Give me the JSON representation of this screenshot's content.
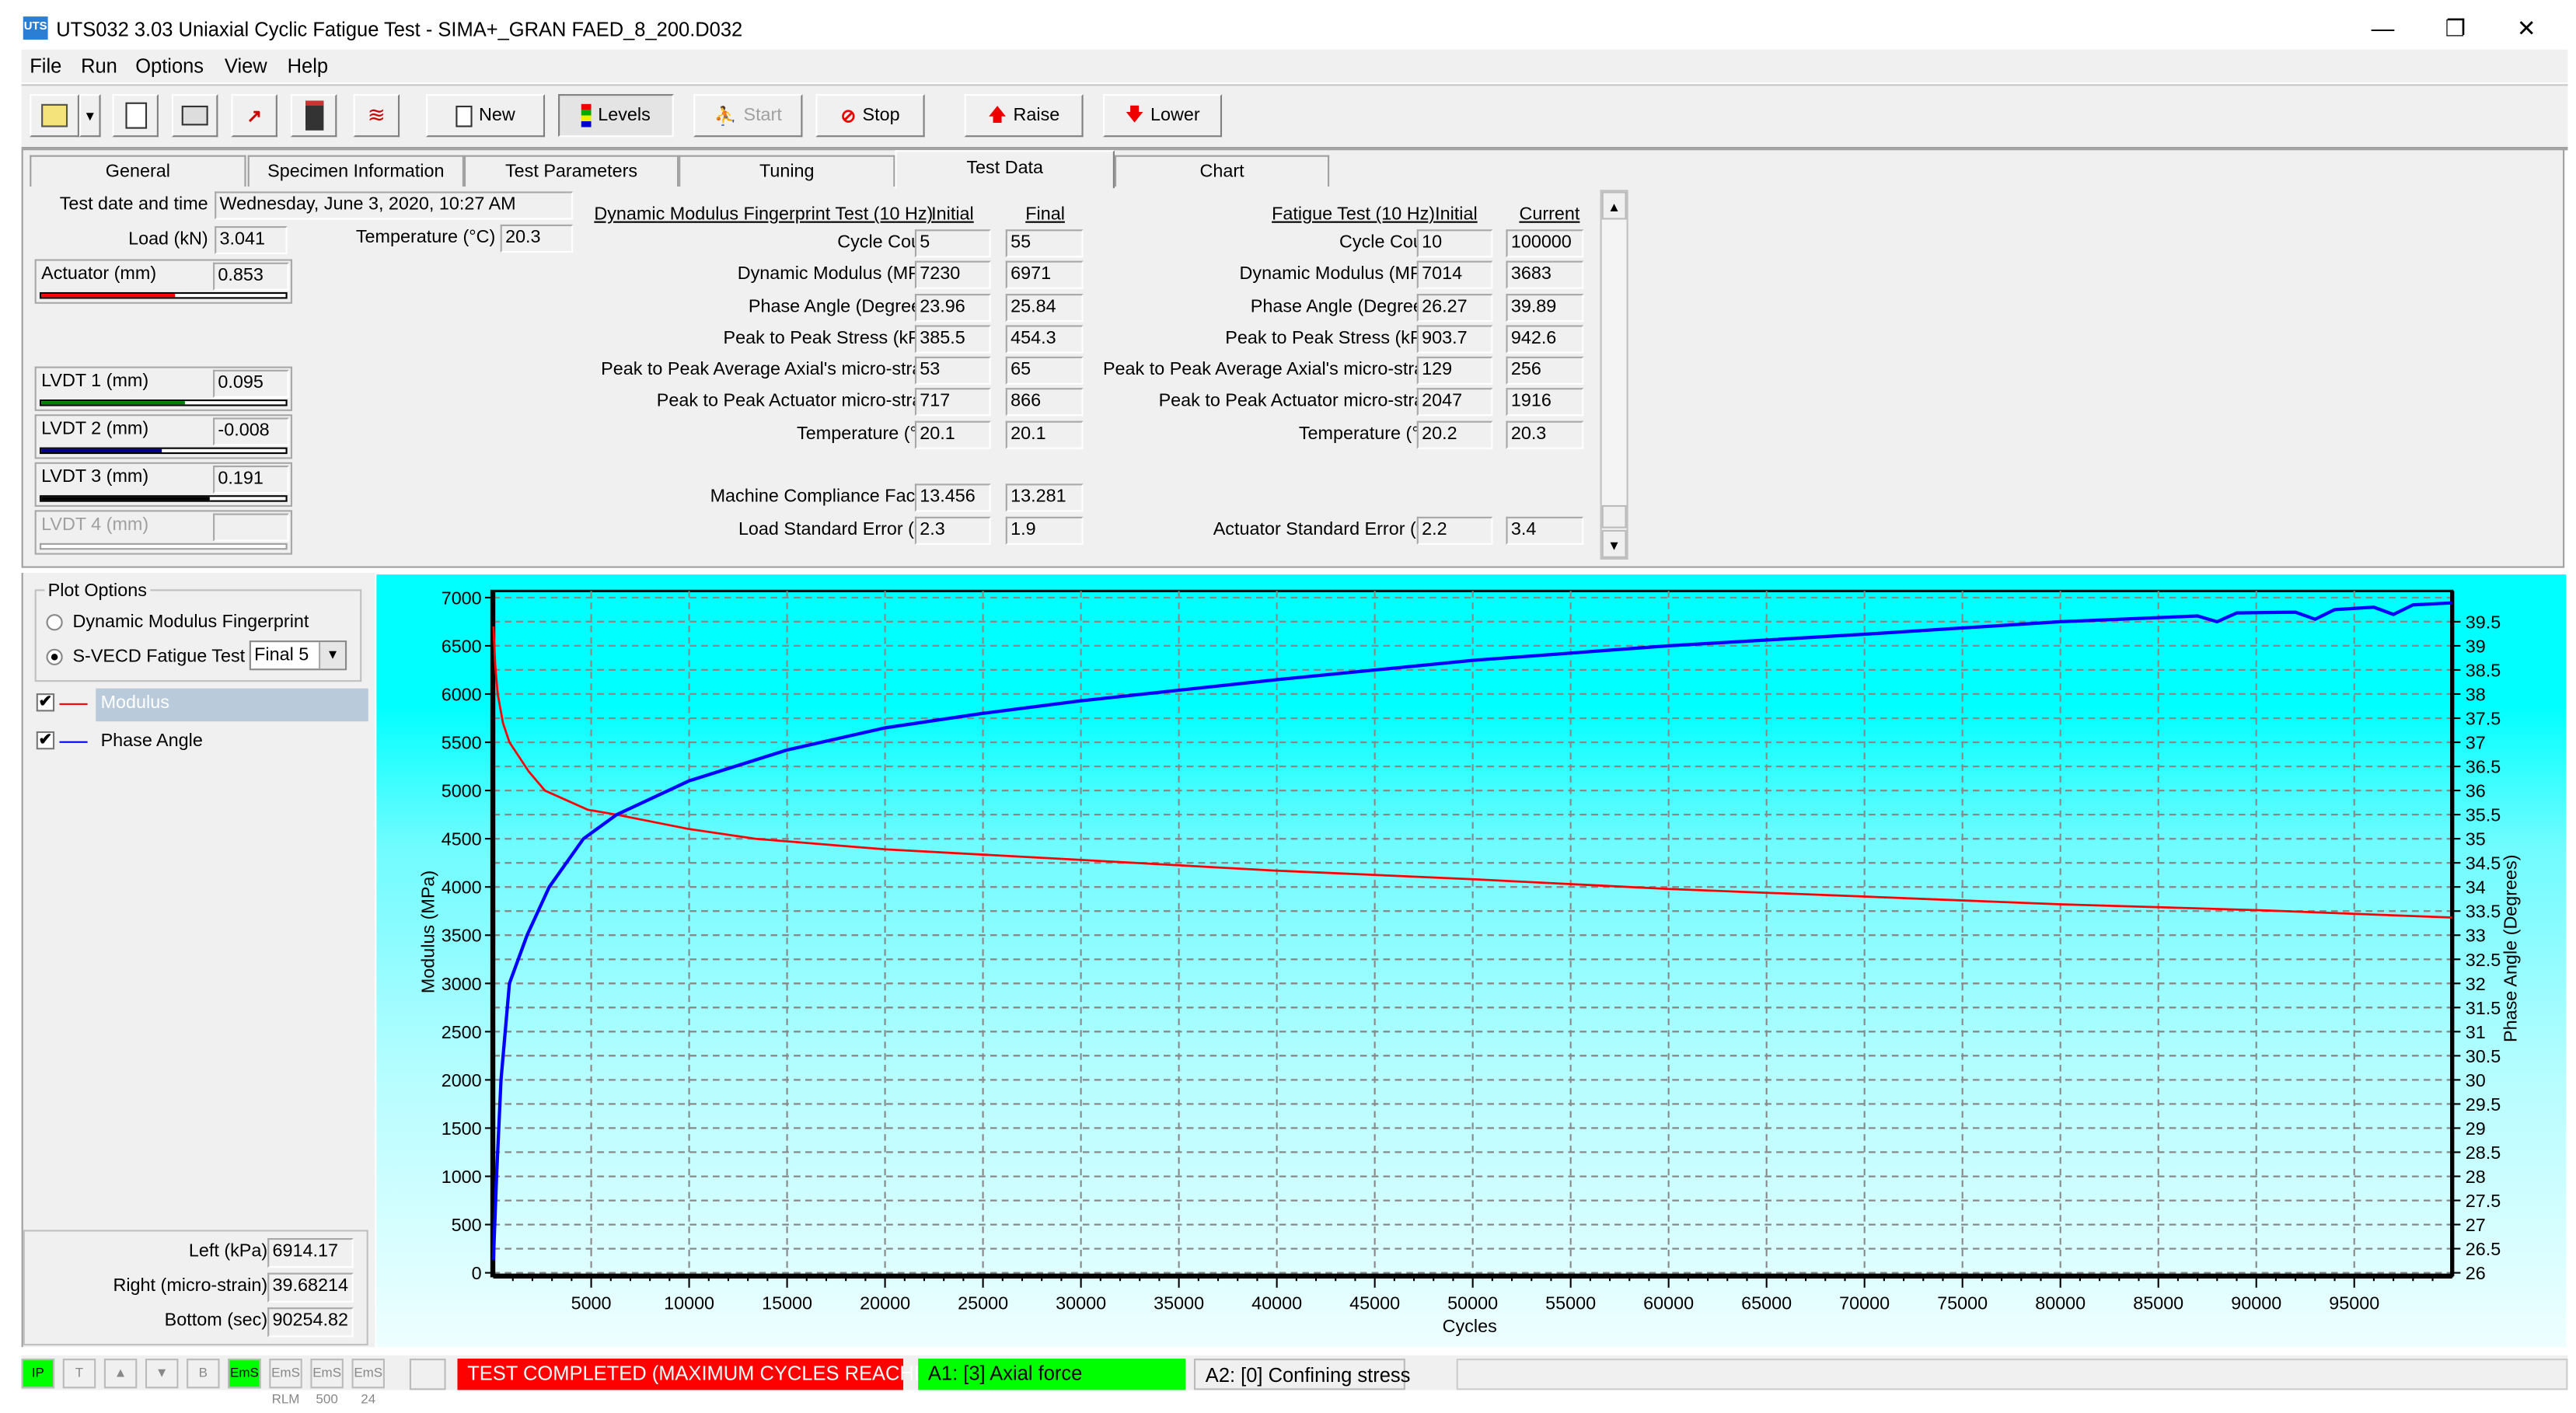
{
  "window": {
    "title": "UTS032 3.03 Uniaxial Cyclic Fatigue Test - SIMA+_GRAN FAED_8_200.D032",
    "icon_text": "UTS",
    "controls": {
      "minimize": "—",
      "restore": "❐",
      "close": "✕"
    }
  },
  "menu": [
    "File",
    "Run",
    "Options",
    "View",
    "Help"
  ],
  "toolbar": {
    "new": "New",
    "levels": "Levels",
    "start": "Start",
    "stop": "Stop",
    "raise": "Raise",
    "lower": "Lower"
  },
  "tabs": [
    "General",
    "Specimen Information",
    "Test Parameters",
    "Tuning",
    "Test Data",
    "Chart"
  ],
  "active_tab": "Test Data",
  "header": {
    "date_label": "Test date and time",
    "date_value": "Wednesday, June 3, 2020, 10:27 AM",
    "load_label": "Load (kN)",
    "load_value": "3.041",
    "temp_label": "Temperature (°C)",
    "temp_value": "20.3"
  },
  "gauges": [
    {
      "label": "Actuator (mm)",
      "value": "0.853",
      "fill": 0.55,
      "color": "#ff0000"
    },
    {
      "label": "LVDT 1 (mm)",
      "value": "0.095",
      "fill": 0.59,
      "color": "#008000"
    },
    {
      "label": "LVDT 2 (mm)",
      "value": "-0.008",
      "fill": 0.49,
      "color": "#000080"
    },
    {
      "label": "LVDT 3 (mm)",
      "value": "0.191",
      "fill": 0.69,
      "color": "#000000"
    },
    {
      "label": "LVDT 4 (mm)",
      "value": "",
      "fill": 0,
      "color": "#a0a0a0",
      "disabled": true
    }
  ],
  "dm": {
    "title": "Dynamic Modulus Fingerprint Test (10 Hz)",
    "col1": "Initial",
    "col2": "Final",
    "rows": [
      {
        "label": "Cycle Count",
        "a": "5",
        "b": "55"
      },
      {
        "label": "Dynamic Modulus (MPa)",
        "a": "7230",
        "b": "6971"
      },
      {
        "label": "Phase Angle (Degrees)",
        "a": "23.96",
        "b": "25.84"
      },
      {
        "label": "Peak to Peak Stress (kPa)",
        "a": "385.5",
        "b": "454.3"
      },
      {
        "label": "Peak to Peak Average Axial's micro-strain",
        "a": "53",
        "b": "65"
      },
      {
        "label": "Peak to Peak Actuator micro-strain",
        "a": "717",
        "b": "866"
      },
      {
        "label": "Temperature (°C)",
        "a": "20.1",
        "b": "20.1"
      },
      {
        "label": "Machine Compliance Factor",
        "a": "13.456",
        "b": "13.281"
      },
      {
        "label": "Load Standard Error (%)",
        "a": "2.3",
        "b": "1.9"
      }
    ]
  },
  "fatigue": {
    "title": "Fatigue Test (10 Hz)",
    "col1": "Initial",
    "col2": "Current",
    "rows": [
      {
        "label": "Cycle Count",
        "a": "10",
        "b": "100000"
      },
      {
        "label": "Dynamic Modulus (MPa)",
        "a": "7014",
        "b": "3683"
      },
      {
        "label": "Phase Angle (Degrees)",
        "a": "26.27",
        "b": "39.89"
      },
      {
        "label": "Peak to Peak Stress (kPa)",
        "a": "903.7",
        "b": "942.6"
      },
      {
        "label": "Peak to Peak Average Axial's micro-strain",
        "a": "129",
        "b": "256"
      },
      {
        "label": "Peak to Peak Actuator micro-strain",
        "a": "2047",
        "b": "1916"
      },
      {
        "label": "Temperature (°C)",
        "a": "20.2",
        "b": "20.3"
      },
      {
        "label": "Actuator Standard Error (%)",
        "a": "2.2",
        "b": "3.4"
      }
    ]
  },
  "plot_options": {
    "title": "Plot Options",
    "radio1": "Dynamic Modulus Fingerprint",
    "radio2": "S-VECD Fatigue Test",
    "selected_radio": 2,
    "select_value": "Final 5"
  },
  "legend": [
    {
      "label": "Modulus",
      "color": "#ff0000",
      "checked": true,
      "highlighted": true
    },
    {
      "label": "Phase Angle",
      "color": "#0000ff",
      "checked": true
    }
  ],
  "cursor": [
    {
      "label": "Left (kPa)",
      "value": "6914.17"
    },
    {
      "label": "Right (micro-strain)",
      "value": "39.68214"
    },
    {
      "label": "Bottom (sec)",
      "value": "90254.82"
    }
  ],
  "status": {
    "completed": "TEST COMPLETED (MAXIMUM CYCLES REACHED)",
    "completed_color": "#ff0000",
    "a1": "A1: [3] Axial force",
    "a1_color": "#00ff00",
    "a2": "A2: [0] Confining stress",
    "icons": [
      "IP",
      "T",
      "▲",
      "▼",
      "B",
      "EmS",
      "EmS RLM",
      "EmS 500",
      "EmS 24"
    ]
  },
  "chart_data": {
    "type": "line",
    "xlabel": "Cycles",
    "ylabel": "Modulus (MPa)",
    "y2label": "Phase Angle (Degrees)",
    "xlim": [
      0,
      100000
    ],
    "ylim": [
      0,
      7000
    ],
    "y2lim": [
      26,
      40
    ],
    "grid": true,
    "xticks": [
      5000,
      10000,
      15000,
      20000,
      25000,
      30000,
      35000,
      40000,
      45000,
      50000,
      55000,
      60000,
      65000,
      70000,
      75000,
      80000,
      85000,
      90000,
      95000
    ],
    "yticks": [
      0,
      500,
      1000,
      1500,
      2000,
      2500,
      3000,
      3500,
      4000,
      4500,
      5000,
      5500,
      6000,
      6500,
      7000
    ],
    "y2ticks": [
      26,
      26.5,
      27,
      27.5,
      28,
      28.5,
      29,
      29.5,
      30,
      30.5,
      31,
      31.5,
      32,
      32.5,
      33,
      33.5,
      34,
      34.5,
      35,
      35.5,
      36,
      36.5,
      37,
      37.5,
      38,
      38.5,
      39,
      39.5
    ],
    "series": [
      {
        "name": "Modulus",
        "axis": "left",
        "color": "#ff0000",
        "x": [
          10,
          100,
          225,
          500,
          830,
          1800,
          2640,
          4820,
          6300,
          10000,
          13400,
          17600,
          20000,
          30000,
          40000,
          50000,
          60000,
          70000,
          80000,
          90000,
          100000
        ],
        "y": [
          6700,
          6300,
          6000,
          5700,
          5500,
          5200,
          5000,
          4800,
          4750,
          4600,
          4500,
          4430,
          4390,
          4280,
          4170,
          4080,
          3980,
          3900,
          3820,
          3760,
          3683
        ]
      },
      {
        "name": "Phase Angle",
        "axis": "right",
        "color": "#0000ff",
        "x": [
          10,
          170,
          400,
          830,
          1730,
          2860,
          4600,
          6300,
          10000,
          15000,
          20000,
          25000,
          30000,
          40000,
          50000,
          60000,
          70000,
          80000,
          87000,
          88000,
          89000,
          92000,
          93000,
          94000,
          96000,
          97000,
          98000,
          100000
        ],
        "y": [
          26.27,
          28,
          30,
          32,
          33,
          34,
          35,
          35.5,
          36.2,
          36.84,
          37.3,
          37.6,
          37.86,
          38.3,
          38.7,
          39.0,
          39.24,
          39.5,
          39.62,
          39.5,
          39.68,
          39.7,
          39.55,
          39.75,
          39.8,
          39.65,
          39.85,
          39.89
        ]
      }
    ]
  }
}
